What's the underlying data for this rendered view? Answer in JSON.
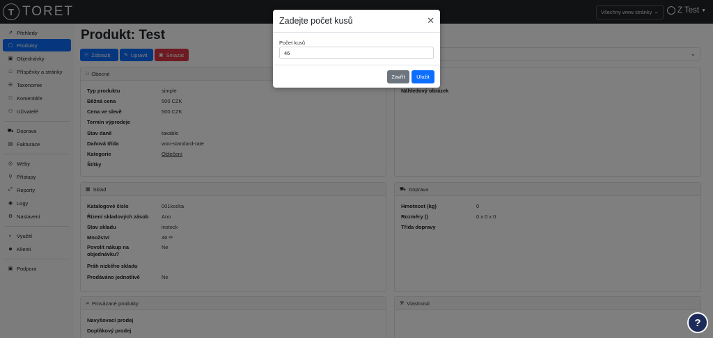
{
  "brand": {
    "logo_letter": "T",
    "logo_text": "TORET"
  },
  "topbar": {
    "site_select": "Všechny www stránky",
    "user": "Z Test"
  },
  "sidebar": {
    "items": [
      {
        "label": "Přehledy",
        "icon": "chart-icon"
      },
      {
        "label": "Produkty",
        "icon": "box-icon",
        "active": true
      },
      {
        "label": "Objednávky",
        "icon": "cart-icon"
      },
      {
        "label": "Příspěvky a stránky",
        "icon": "file-icon"
      },
      {
        "label": "Taxonomie",
        "icon": "list-icon"
      },
      {
        "label": "Komentáře",
        "icon": "comment-icon"
      },
      {
        "label": "Uživatelé",
        "icon": "users-icon"
      },
      {
        "label": "Doprava",
        "icon": "truck-icon"
      },
      {
        "label": "Fakturace",
        "icon": "invoice-icon"
      },
      {
        "label": "Weby",
        "icon": "globe-icon"
      },
      {
        "label": "Přístupy",
        "icon": "key-icon"
      },
      {
        "label": "Reporty",
        "icon": "share-icon"
      },
      {
        "label": "Logy",
        "icon": "lock-icon"
      },
      {
        "label": "Nastavení",
        "icon": "gear-icon"
      },
      {
        "label": "Využití",
        "icon": "gauge-icon"
      },
      {
        "label": "Klienti",
        "icon": "user-icon"
      },
      {
        "label": "Podpora",
        "icon": "support-icon"
      }
    ]
  },
  "main": {
    "title": "Produkt: Test",
    "buttons": {
      "view": "Zobrazit",
      "edit": "Upravit",
      "delete": "Smazat"
    },
    "general": {
      "title": "Obecné",
      "rows": [
        {
          "label": "Typ produktu",
          "value": "simple"
        },
        {
          "label": "Běžná cena",
          "value": "500 CZK"
        },
        {
          "label": "Cena ve slevě",
          "value": "500 CZK"
        },
        {
          "label": "Termín výprodeje",
          "value": ""
        },
        {
          "label": "Stav daně",
          "value": "taxable"
        },
        {
          "label": "Daňová třída",
          "value": "woo-standard-rate"
        },
        {
          "label": "Kategorie",
          "value": "Oblečení"
        },
        {
          "label": "Štítky",
          "value": ""
        }
      ]
    },
    "image": {
      "label": "Náhledový obrázek"
    },
    "stock": {
      "title": "Sklad",
      "rows": [
        {
          "label": "Katalogové číslo",
          "value": "001kocka"
        },
        {
          "label": "Řízení skladových zásob",
          "value": "Ano"
        },
        {
          "label": "Stav skladu",
          "value": "instock"
        },
        {
          "label": "Množství",
          "value": "46"
        },
        {
          "label": "Povolit nákup na objednávku?",
          "value": "Ne"
        },
        {
          "label": "Práh nízkého skladu",
          "value": ""
        },
        {
          "label": "Prodáváno jednotlivě",
          "value": "Ne"
        }
      ]
    },
    "shipping": {
      "title": "Doprava",
      "rows": [
        {
          "label": "Hmotnost (kg)",
          "value": "0"
        },
        {
          "label": "Rozměry ()",
          "value": "0 x 0 x 0"
        },
        {
          "label": "Třída dopravy",
          "value": ""
        }
      ]
    },
    "linked": {
      "title": "Provázané produkty",
      "rows": [
        {
          "label": "Navyšovací prodej"
        },
        {
          "label": "Doplňkový prodej"
        }
      ]
    },
    "properties": {
      "title": "Vlastnosti"
    }
  },
  "modal": {
    "title": "Zadejte počet kusů",
    "field_label": "Počet kusů",
    "field_value": "46",
    "close_label": "Zavřít",
    "save_label": "Uložit"
  },
  "help": {
    "label": "?"
  }
}
